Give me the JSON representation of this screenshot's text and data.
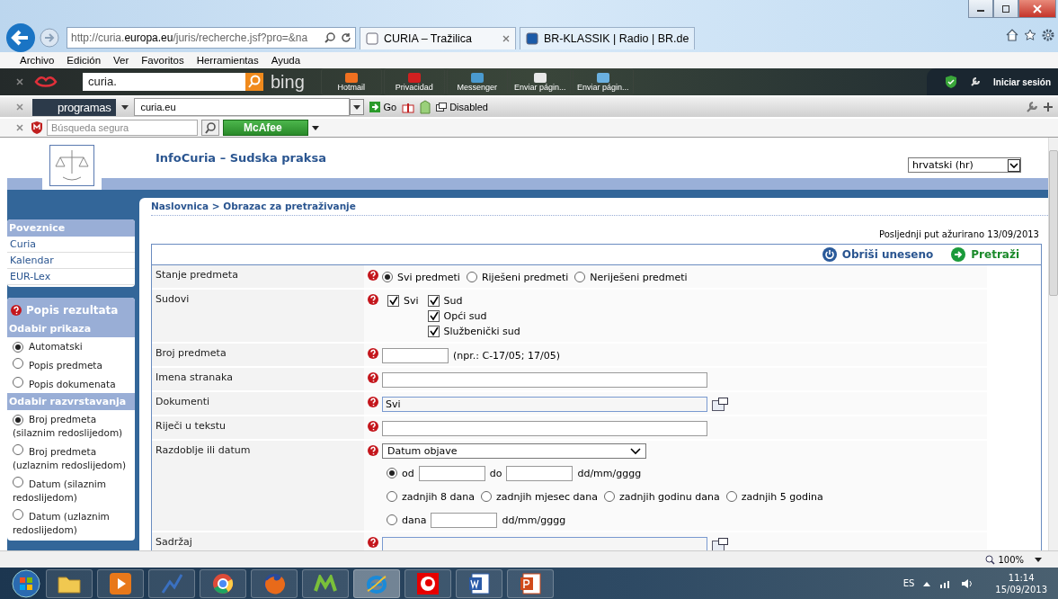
{
  "browser": {
    "address": "http://curia.**europa.eu**/juris/recherche.jsf?pro=&na",
    "tabs": [
      {
        "label": "CURIA – Tražilica",
        "selected": true
      },
      {
        "label": "BR-KLASSIK | Radio | BR.de",
        "selected": false
      }
    ],
    "menu": [
      "Archivo",
      "Edición",
      "Ver",
      "Favoritos",
      "Herramientas",
      "Ayuda"
    ]
  },
  "bing_toolbar": {
    "search": "curia.",
    "brand": "bing",
    "buttons": [
      "Hotmail",
      "Privacidad",
      "Messenger",
      "Enviar págin...",
      "Enviar págin..."
    ],
    "signin": "Iniciar sesión"
  },
  "programas_toolbar": {
    "brand": "programas",
    "address": "curia.eu",
    "go": "Go",
    "disabled": "Disabled"
  },
  "mcafee_toolbar": {
    "placeholder": "Búsqueda segura",
    "badge": "McAfee"
  },
  "page": {
    "title": "InfoCuria – Sudska praksa",
    "language": "hrvatski (hr)",
    "breadcrumb": "Naslovnica > Obrazac za pretraživanje",
    "updated": "Posljednji put ažurirano 13/09/2013",
    "clear": "Obriši uneseno",
    "search": "Pretraži"
  },
  "sidebar": {
    "links_title": "Poveznice",
    "links": [
      "Curia",
      "Kalendar",
      "EUR-Lex"
    ],
    "results_title": "Popis rezultata",
    "display_title": "Odabir prikaza",
    "display_options": [
      {
        "label": "Automatski",
        "selected": true
      },
      {
        "label": "Popis predmeta",
        "selected": false
      },
      {
        "label": "Popis dokumenata",
        "selected": false
      }
    ],
    "sort_title": "Odabir razvrstavanja",
    "sort_options": [
      {
        "label": "Broj predmeta (silaznim redoslijedom)",
        "selected": true
      },
      {
        "label": "Broj predmeta (uzlaznim redoslijedom)",
        "selected": false
      },
      {
        "label": "Datum (silaznim redoslijedom)",
        "selected": false
      },
      {
        "label": "Datum (uzlaznim redoslijedom)",
        "selected": false
      }
    ]
  },
  "form": [
    {
      "kind": "radio",
      "label": "Stanje predmeta",
      "options": [
        {
          "label": "Svi predmeti",
          "selected": true
        },
        {
          "label": "Riješeni predmeti",
          "selected": false
        },
        {
          "label": "Neriješeni predmeti",
          "selected": false
        }
      ]
    },
    {
      "kind": "checks",
      "label": "Sudovi",
      "all": {
        "label": "Svi",
        "checked": true
      },
      "options": [
        {
          "label": "Sud",
          "checked": true
        },
        {
          "label": "Opći sud",
          "checked": true
        },
        {
          "label": "Službenički sud",
          "checked": true
        }
      ]
    },
    {
      "kind": "text",
      "label": "Broj predmeta",
      "hint": "(npr.: C-17/05; 17/05)"
    },
    {
      "kind": "text",
      "label": "Imena stranaka"
    },
    {
      "kind": "picker",
      "label": "Dokumenti",
      "value": "Svi"
    },
    {
      "kind": "text",
      "label": "Riječi u tekstu"
    },
    {
      "kind": "period",
      "label": "Razdoblje ili datum",
      "select": "Datum objave",
      "range": {
        "selected": true,
        "from": "od",
        "to": "do",
        "format": "dd/mm/gggg"
      },
      "presets": [
        {
          "label": "zadnjih 8 dana",
          "selected": false
        },
        {
          "label": "zadnjih mjesec dana",
          "selected": false
        },
        {
          "label": "zadnjih godinu dana",
          "selected": false
        },
        {
          "label": "zadnjih 5 godina",
          "selected": false
        }
      ],
      "single": {
        "label": "dana",
        "selected": false,
        "format": "dd/mm/gggg"
      }
    },
    {
      "kind": "picker",
      "label": "Sadržaj"
    }
  ],
  "status_bar": {
    "zoom": "100%"
  },
  "taskbar": {
    "language": "ES",
    "time": "11:14",
    "date": "15/09/2013"
  }
}
